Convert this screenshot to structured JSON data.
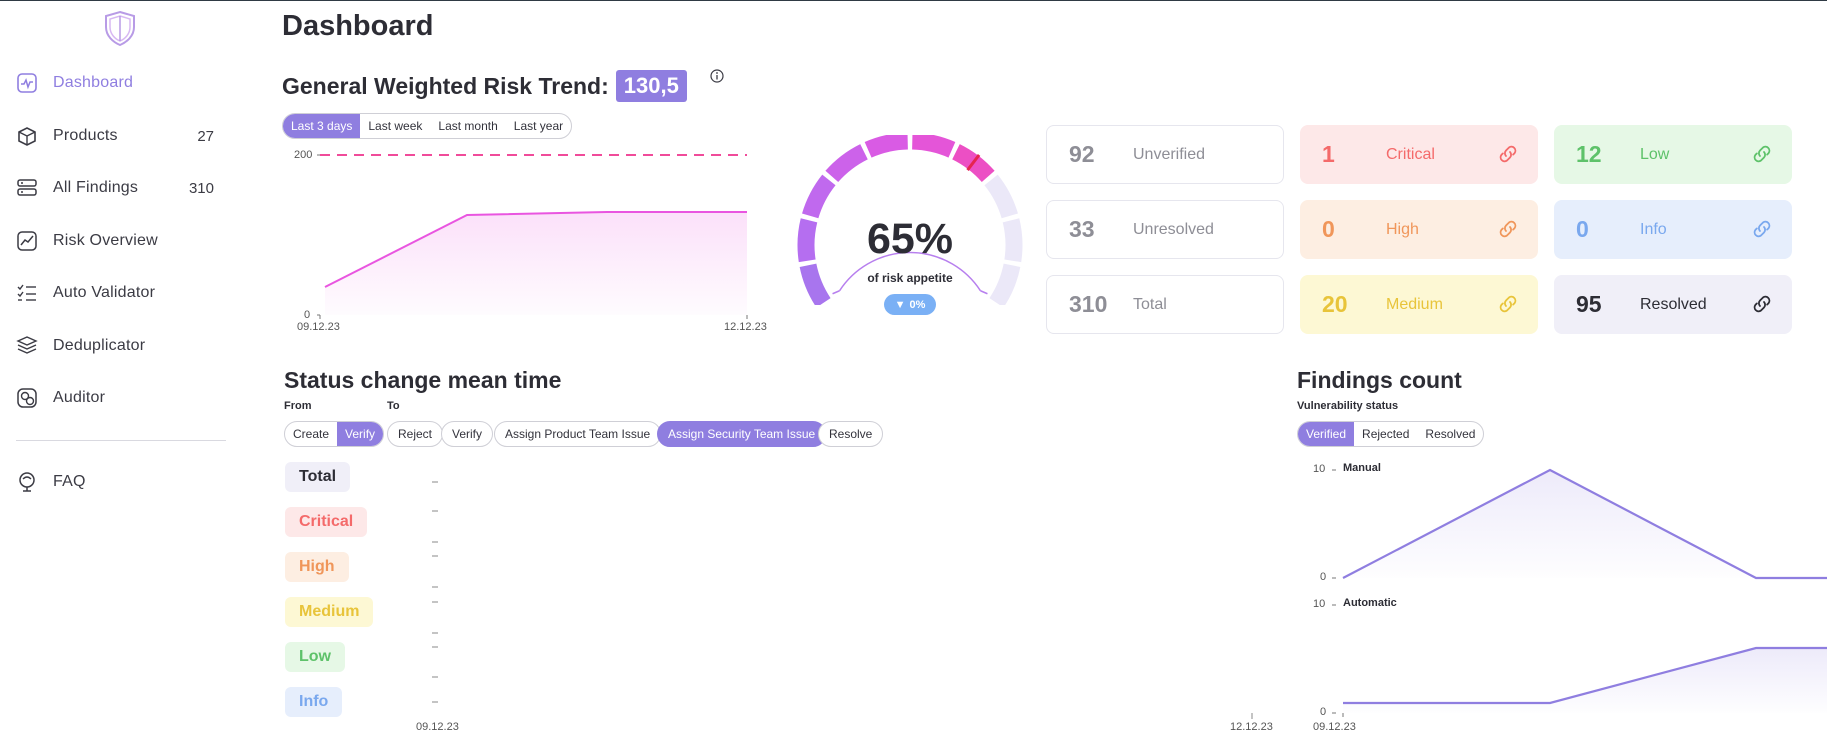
{
  "sidebar": {
    "items": [
      {
        "label": "Dashboard",
        "count": "",
        "icon": "dashboard-icon",
        "active": true
      },
      {
        "label": "Products",
        "count": "27",
        "icon": "products-icon"
      },
      {
        "label": "All Findings",
        "count": "310",
        "icon": "findings-icon"
      },
      {
        "label": "Risk Overview",
        "count": "",
        "icon": "risk-overview-icon"
      },
      {
        "label": "Auto Validator",
        "count": "",
        "icon": "auto-validator-icon"
      },
      {
        "label": "Deduplicator",
        "count": "",
        "icon": "deduplicator-icon"
      },
      {
        "label": "Auditor",
        "count": "",
        "icon": "auditor-icon"
      }
    ],
    "faq": {
      "label": "FAQ",
      "icon": "faq-icon"
    }
  },
  "header": {
    "title": "Dashboard",
    "risk_trend_label": "General Weighted Risk Trend:",
    "risk_trend_value": "130,5"
  },
  "risk_trend": {
    "periods": [
      "Last 3 days",
      "Last week",
      "Last month",
      "Last year"
    ],
    "selected_period": "Last 3 days",
    "y_ticks": [
      "200",
      "0"
    ],
    "x_ticks": [
      "09.12.23",
      "12.12.23"
    ]
  },
  "gauge": {
    "value": "65%",
    "label": "of risk appetite",
    "change": "0%",
    "fraction": 0.65
  },
  "summary_cards": [
    {
      "key": "unverified",
      "value": "92",
      "label": "Unverified"
    },
    {
      "key": "unresolved",
      "value": "33",
      "label": "Unresolved"
    },
    {
      "key": "total",
      "value": "310",
      "label": "Total"
    }
  ],
  "severity_cards": [
    {
      "key": "critical",
      "value": "1",
      "label": "Critical",
      "color": "#f46a6a",
      "bg": "#fde8e8"
    },
    {
      "key": "low",
      "value": "12",
      "label": "Low",
      "color": "#5ec26a",
      "bg": "#e6f8e6"
    },
    {
      "key": "high",
      "value": "0",
      "label": "High",
      "color": "#f0965a",
      "bg": "#fdeee2"
    },
    {
      "key": "info",
      "value": "0",
      "label": "Info",
      "color": "#7aa8ee",
      "bg": "#e6eefc"
    },
    {
      "key": "medium",
      "value": "20",
      "label": "Medium",
      "color": "#e8c43a",
      "bg": "#fdf8d4"
    },
    {
      "key": "resolved",
      "value": "95",
      "label": "Resolved",
      "color": "#2d2d35",
      "bg": "#f0eff8"
    }
  ],
  "status_change": {
    "title": "Status change mean time",
    "from_label": "From",
    "to_label": "To",
    "from_options": [
      "Create",
      "Verify"
    ],
    "from_selected": "Verify",
    "to_options": [
      "Reject",
      "Verify",
      "Assign Product Team Issue",
      "Assign Security Team Issue",
      "Resolve"
    ],
    "to_selected": "Assign Security Team Issue",
    "severities": [
      {
        "label": "Total",
        "color": "#2d2d35",
        "bg": "#f0eff8"
      },
      {
        "label": "Critical",
        "color": "#f46a6a",
        "bg": "#fde8e8"
      },
      {
        "label": "High",
        "color": "#f0965a",
        "bg": "#fdeee2"
      },
      {
        "label": "Medium",
        "color": "#e8c43a",
        "bg": "#fdf8d4"
      },
      {
        "label": "Low",
        "color": "#5ec26a",
        "bg": "#e6f8e6"
      },
      {
        "label": "Info",
        "color": "#7aa8ee",
        "bg": "#e6eefc"
      }
    ],
    "x_ticks": [
      "09.12.23",
      "12.12.23"
    ]
  },
  "findings_count": {
    "title": "Findings count",
    "subtitle": "Vulnerability status",
    "options": [
      "Verified",
      "Rejected",
      "Resolved"
    ],
    "selected": "Verified",
    "manual_label": "Manual",
    "automatic_label": "Automatic",
    "y_ticks": [
      "10",
      "0"
    ],
    "x_tick": "09.12.23"
  },
  "colors": {
    "accent": "#8f7ee0",
    "trend_line": "#e955e0"
  }
}
